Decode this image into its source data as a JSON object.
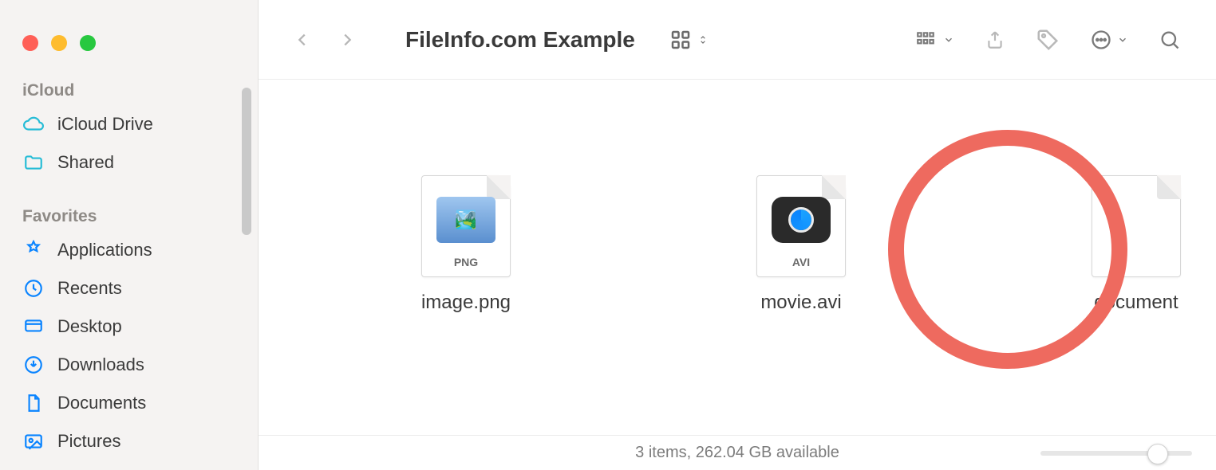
{
  "window": {
    "title": "FileInfo.com Example"
  },
  "sidebar": {
    "sections": [
      {
        "label": "iCloud",
        "items": [
          {
            "label": "iCloud Drive",
            "icon": "cloud-icon"
          },
          {
            "label": "Shared",
            "icon": "folder-shared-icon"
          }
        ]
      },
      {
        "label": "Favorites",
        "items": [
          {
            "label": "Applications",
            "icon": "apps-icon"
          },
          {
            "label": "Recents",
            "icon": "clock-icon"
          },
          {
            "label": "Desktop",
            "icon": "desktop-icon"
          },
          {
            "label": "Downloads",
            "icon": "download-icon"
          },
          {
            "label": "Documents",
            "icon": "document-icon"
          },
          {
            "label": "Pictures",
            "icon": "pictures-icon"
          }
        ]
      }
    ]
  },
  "files": [
    {
      "name": "image.png",
      "badge": "PNG",
      "kind": "png"
    },
    {
      "name": "movie.avi",
      "badge": "AVI",
      "kind": "avi"
    },
    {
      "name": "document",
      "badge": "",
      "kind": "blank",
      "highlight": true
    }
  ],
  "status": {
    "text": "3 items, 262.04 GB available"
  },
  "annotation": {
    "circle_color": "#ee6a5f"
  }
}
